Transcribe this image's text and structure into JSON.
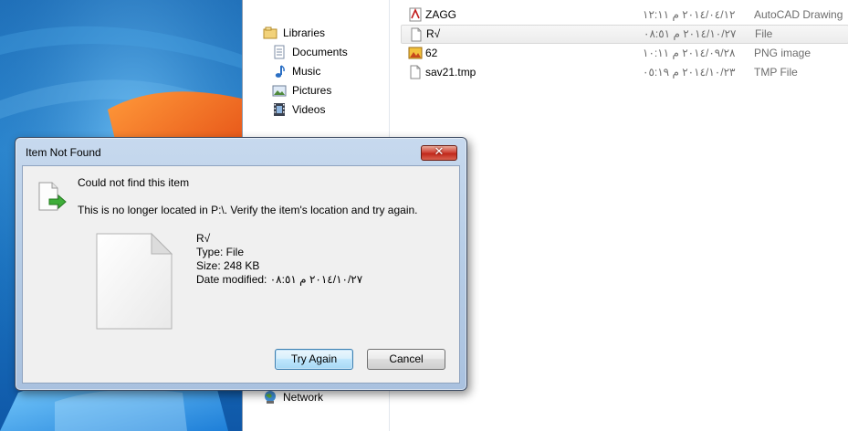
{
  "colors": {
    "accent_blue": "#3c7fb1",
    "close_red": "#c0281b",
    "secondary_text": "#6d6d6d"
  },
  "explorer": {
    "nav": [
      {
        "label": "Libraries",
        "icon": "libraries-icon"
      },
      {
        "label": "Documents",
        "icon": "documents-icon"
      },
      {
        "label": "Music",
        "icon": "music-icon"
      },
      {
        "label": "Pictures",
        "icon": "pictures-icon"
      },
      {
        "label": "Videos",
        "icon": "videos-icon"
      },
      {
        "label": "Network",
        "icon": "network-icon"
      }
    ],
    "files": [
      {
        "name": "ZAGG",
        "date": "٢٠١٤/٠٤/١٢ م ١٢:١١",
        "type": "AutoCAD Drawing",
        "icon": "autocad-file-icon",
        "selected": false
      },
      {
        "name": "R√",
        "date": "٢٠١٤/١٠/٢٧ م ٠٨:٥١",
        "type": "File",
        "icon": "generic-file-icon",
        "selected": true
      },
      {
        "name": "62",
        "date": "٢٠١٤/٠٩/٢٨ م ١٠:١١",
        "type": "PNG image",
        "icon": "png-file-icon",
        "selected": false
      },
      {
        "name": "sav21.tmp",
        "date": "٢٠١٤/١٠/٢٣ م ٠٥:١٩",
        "type": "TMP File",
        "icon": "tmp-file-icon",
        "selected": false
      }
    ]
  },
  "dialog": {
    "title": "Item Not Found",
    "close_label": "✕",
    "heading": "Could not find this item",
    "message": "This is no longer located in P:\\. Verify the item's location and try again.",
    "item_name": "R√",
    "type_line": "Type: File",
    "size_line": "Size: 248 KB",
    "date_line": "Date modified: ٢٠١٤/١٠/٢٧ م ٠٨:٥١",
    "try_again_label": "Try Again",
    "cancel_label": "Cancel"
  }
}
